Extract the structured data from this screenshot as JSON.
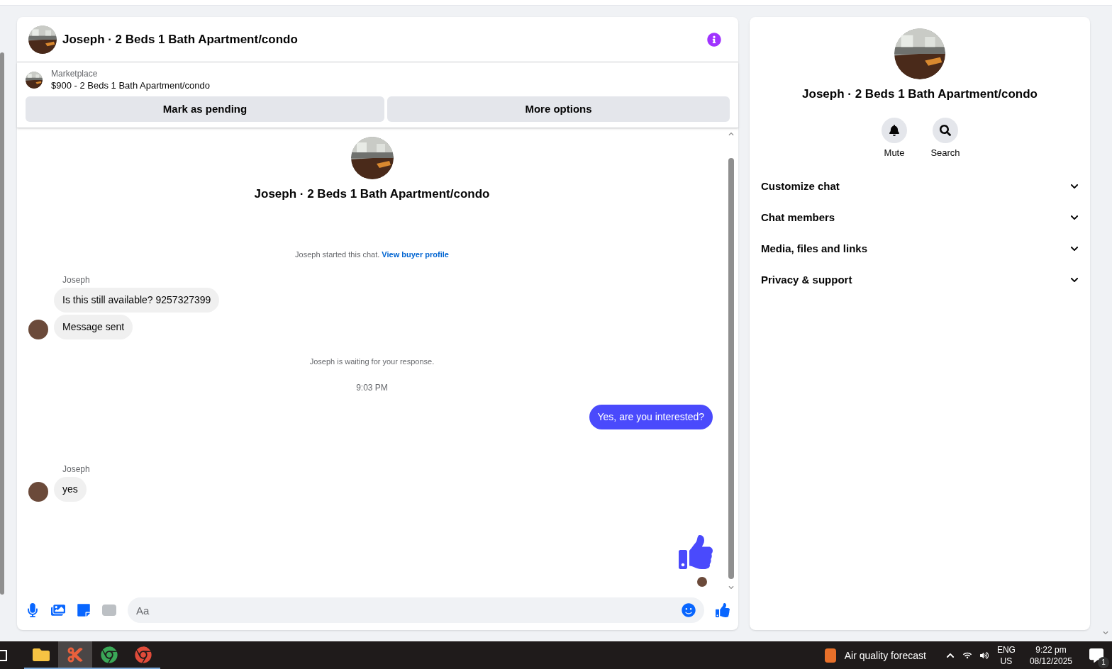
{
  "chat": {
    "title": "Joseph · 2 Beds 1 Bath Apartment/condo",
    "listing": {
      "source": "Marketplace",
      "summary": "$900 - 2 Beds 1 Bath Apartment/condo"
    },
    "actions": [
      "Mark as pending",
      "More options"
    ],
    "intro_title": "Joseph · 2 Beds 1 Bath Apartment/condo",
    "messages": [
      {
        "kind": "system",
        "text": "Joseph started this chat.",
        "link": "View buyer profile"
      },
      {
        "kind": "group",
        "sender": "Joseph",
        "bubbles": [
          "Is this still available? 9257327399",
          "Message sent"
        ]
      },
      {
        "kind": "system",
        "text": "Joseph is waiting for your response."
      },
      {
        "kind": "time",
        "text": "9:03 PM"
      },
      {
        "kind": "outgoing",
        "text": "Yes, are you interested?"
      },
      {
        "kind": "group",
        "sender": "Joseph",
        "bubbles": [
          "yes"
        ]
      },
      {
        "kind": "like"
      }
    ],
    "composer": {
      "placeholder": "Aa"
    }
  },
  "details": {
    "title": "Joseph · 2 Beds 1 Bath Apartment/condo",
    "actions": [
      {
        "kind": "mute",
        "label": "Mute"
      },
      {
        "kind": "search",
        "label": "Search"
      }
    ],
    "sections": [
      {
        "label": "Customize chat",
        "expanded": false
      },
      {
        "label": "Chat members",
        "expanded": false
      },
      {
        "label": "Media, files and links",
        "expanded": false
      },
      {
        "label": "Privacy & support",
        "expanded": false
      }
    ]
  },
  "taskbar": {
    "apps": [
      {
        "kind": "explorer",
        "active": false
      },
      {
        "kind": "snip",
        "active": true
      },
      {
        "kind": "chrome",
        "active": false
      },
      {
        "kind": "chrome-profile",
        "active": false
      }
    ],
    "weather": "Air quality forecast",
    "language": "ENG",
    "region": "US",
    "time": "9:22 pm",
    "date": "08/12/2025",
    "notifications": "1"
  }
}
